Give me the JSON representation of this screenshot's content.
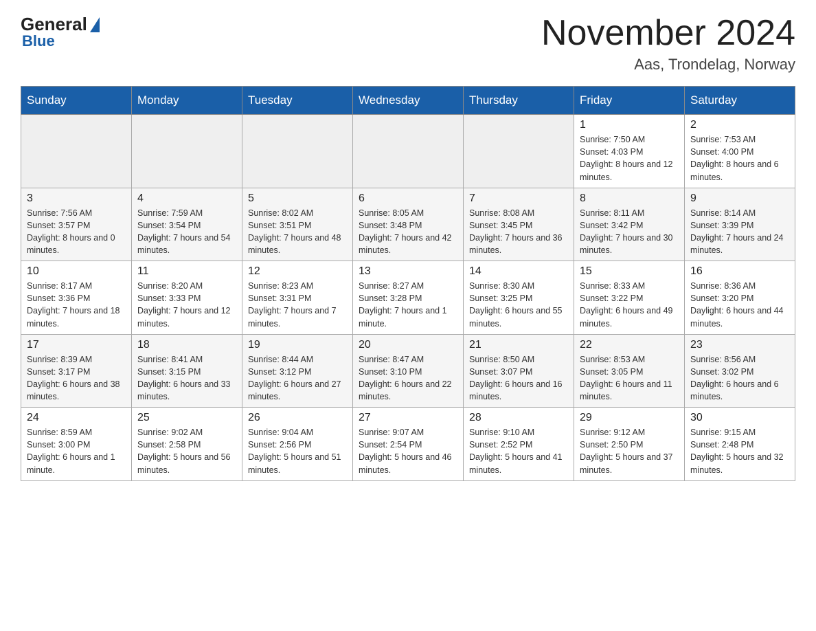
{
  "header": {
    "logo_general": "General",
    "logo_blue": "Blue",
    "title": "November 2024",
    "subtitle": "Aas, Trondelag, Norway"
  },
  "weekdays": [
    "Sunday",
    "Monday",
    "Tuesday",
    "Wednesday",
    "Thursday",
    "Friday",
    "Saturday"
  ],
  "rows": [
    {
      "cells": [
        {
          "day": "",
          "sunrise": "",
          "sunset": "",
          "daylight": ""
        },
        {
          "day": "",
          "sunrise": "",
          "sunset": "",
          "daylight": ""
        },
        {
          "day": "",
          "sunrise": "",
          "sunset": "",
          "daylight": ""
        },
        {
          "day": "",
          "sunrise": "",
          "sunset": "",
          "daylight": ""
        },
        {
          "day": "",
          "sunrise": "",
          "sunset": "",
          "daylight": ""
        },
        {
          "day": "1",
          "sunrise": "Sunrise: 7:50 AM",
          "sunset": "Sunset: 4:03 PM",
          "daylight": "Daylight: 8 hours and 12 minutes."
        },
        {
          "day": "2",
          "sunrise": "Sunrise: 7:53 AM",
          "sunset": "Sunset: 4:00 PM",
          "daylight": "Daylight: 8 hours and 6 minutes."
        }
      ]
    },
    {
      "cells": [
        {
          "day": "3",
          "sunrise": "Sunrise: 7:56 AM",
          "sunset": "Sunset: 3:57 PM",
          "daylight": "Daylight: 8 hours and 0 minutes."
        },
        {
          "day": "4",
          "sunrise": "Sunrise: 7:59 AM",
          "sunset": "Sunset: 3:54 PM",
          "daylight": "Daylight: 7 hours and 54 minutes."
        },
        {
          "day": "5",
          "sunrise": "Sunrise: 8:02 AM",
          "sunset": "Sunset: 3:51 PM",
          "daylight": "Daylight: 7 hours and 48 minutes."
        },
        {
          "day": "6",
          "sunrise": "Sunrise: 8:05 AM",
          "sunset": "Sunset: 3:48 PM",
          "daylight": "Daylight: 7 hours and 42 minutes."
        },
        {
          "day": "7",
          "sunrise": "Sunrise: 8:08 AM",
          "sunset": "Sunset: 3:45 PM",
          "daylight": "Daylight: 7 hours and 36 minutes."
        },
        {
          "day": "8",
          "sunrise": "Sunrise: 8:11 AM",
          "sunset": "Sunset: 3:42 PM",
          "daylight": "Daylight: 7 hours and 30 minutes."
        },
        {
          "day": "9",
          "sunrise": "Sunrise: 8:14 AM",
          "sunset": "Sunset: 3:39 PM",
          "daylight": "Daylight: 7 hours and 24 minutes."
        }
      ]
    },
    {
      "cells": [
        {
          "day": "10",
          "sunrise": "Sunrise: 8:17 AM",
          "sunset": "Sunset: 3:36 PM",
          "daylight": "Daylight: 7 hours and 18 minutes."
        },
        {
          "day": "11",
          "sunrise": "Sunrise: 8:20 AM",
          "sunset": "Sunset: 3:33 PM",
          "daylight": "Daylight: 7 hours and 12 minutes."
        },
        {
          "day": "12",
          "sunrise": "Sunrise: 8:23 AM",
          "sunset": "Sunset: 3:31 PM",
          "daylight": "Daylight: 7 hours and 7 minutes."
        },
        {
          "day": "13",
          "sunrise": "Sunrise: 8:27 AM",
          "sunset": "Sunset: 3:28 PM",
          "daylight": "Daylight: 7 hours and 1 minute."
        },
        {
          "day": "14",
          "sunrise": "Sunrise: 8:30 AM",
          "sunset": "Sunset: 3:25 PM",
          "daylight": "Daylight: 6 hours and 55 minutes."
        },
        {
          "day": "15",
          "sunrise": "Sunrise: 8:33 AM",
          "sunset": "Sunset: 3:22 PM",
          "daylight": "Daylight: 6 hours and 49 minutes."
        },
        {
          "day": "16",
          "sunrise": "Sunrise: 8:36 AM",
          "sunset": "Sunset: 3:20 PM",
          "daylight": "Daylight: 6 hours and 44 minutes."
        }
      ]
    },
    {
      "cells": [
        {
          "day": "17",
          "sunrise": "Sunrise: 8:39 AM",
          "sunset": "Sunset: 3:17 PM",
          "daylight": "Daylight: 6 hours and 38 minutes."
        },
        {
          "day": "18",
          "sunrise": "Sunrise: 8:41 AM",
          "sunset": "Sunset: 3:15 PM",
          "daylight": "Daylight: 6 hours and 33 minutes."
        },
        {
          "day": "19",
          "sunrise": "Sunrise: 8:44 AM",
          "sunset": "Sunset: 3:12 PM",
          "daylight": "Daylight: 6 hours and 27 minutes."
        },
        {
          "day": "20",
          "sunrise": "Sunrise: 8:47 AM",
          "sunset": "Sunset: 3:10 PM",
          "daylight": "Daylight: 6 hours and 22 minutes."
        },
        {
          "day": "21",
          "sunrise": "Sunrise: 8:50 AM",
          "sunset": "Sunset: 3:07 PM",
          "daylight": "Daylight: 6 hours and 16 minutes."
        },
        {
          "day": "22",
          "sunrise": "Sunrise: 8:53 AM",
          "sunset": "Sunset: 3:05 PM",
          "daylight": "Daylight: 6 hours and 11 minutes."
        },
        {
          "day": "23",
          "sunrise": "Sunrise: 8:56 AM",
          "sunset": "Sunset: 3:02 PM",
          "daylight": "Daylight: 6 hours and 6 minutes."
        }
      ]
    },
    {
      "cells": [
        {
          "day": "24",
          "sunrise": "Sunrise: 8:59 AM",
          "sunset": "Sunset: 3:00 PM",
          "daylight": "Daylight: 6 hours and 1 minute."
        },
        {
          "day": "25",
          "sunrise": "Sunrise: 9:02 AM",
          "sunset": "Sunset: 2:58 PM",
          "daylight": "Daylight: 5 hours and 56 minutes."
        },
        {
          "day": "26",
          "sunrise": "Sunrise: 9:04 AM",
          "sunset": "Sunset: 2:56 PM",
          "daylight": "Daylight: 5 hours and 51 minutes."
        },
        {
          "day": "27",
          "sunrise": "Sunrise: 9:07 AM",
          "sunset": "Sunset: 2:54 PM",
          "daylight": "Daylight: 5 hours and 46 minutes."
        },
        {
          "day": "28",
          "sunrise": "Sunrise: 9:10 AM",
          "sunset": "Sunset: 2:52 PM",
          "daylight": "Daylight: 5 hours and 41 minutes."
        },
        {
          "day": "29",
          "sunrise": "Sunrise: 9:12 AM",
          "sunset": "Sunset: 2:50 PM",
          "daylight": "Daylight: 5 hours and 37 minutes."
        },
        {
          "day": "30",
          "sunrise": "Sunrise: 9:15 AM",
          "sunset": "Sunset: 2:48 PM",
          "daylight": "Daylight: 5 hours and 32 minutes."
        }
      ]
    }
  ]
}
